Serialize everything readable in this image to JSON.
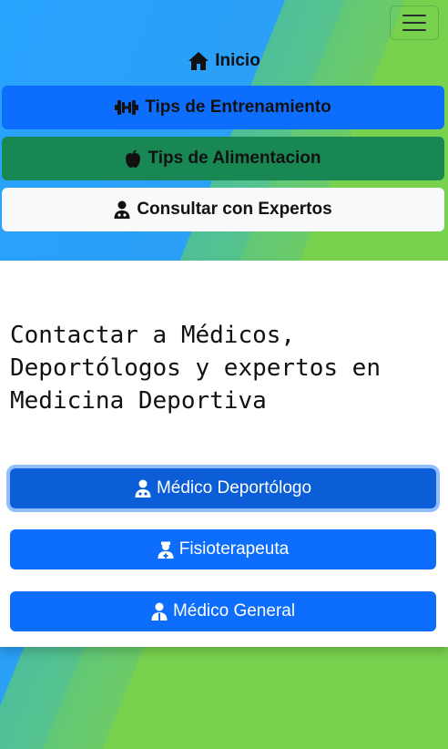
{
  "nav": {
    "home": {
      "label": "Inicio",
      "icon": "home-icon"
    },
    "items": [
      {
        "label": "Tips de Entrenamiento",
        "icon": "dumbbell-icon",
        "color": "#0d6efd"
      },
      {
        "label": "Tips de Alimentacion",
        "icon": "apple-icon",
        "color": "#198754"
      },
      {
        "label": "Consultar con Expertos",
        "icon": "user-doctor-icon",
        "color": "#f8f9fa"
      }
    ],
    "toggler_icon": "hamburger-menu-icon"
  },
  "main": {
    "heading": "Contactar a Médicos,\nDeportólogos y expertos en\nMedicina Deportiva",
    "buttons": [
      {
        "label": "Médico Deportólogo",
        "icon": "user-doctor-icon",
        "state": "focused"
      },
      {
        "label": "Fisioterapeuta",
        "icon": "user-nurse-icon"
      },
      {
        "label": "Médico General",
        "icon": "user-md-icon"
      }
    ]
  },
  "colors": {
    "primary": "#0d6efd",
    "success": "#198754",
    "light": "#f8f9fa",
    "background_green": "#78d24e",
    "background_blue": "#27a3ff"
  }
}
